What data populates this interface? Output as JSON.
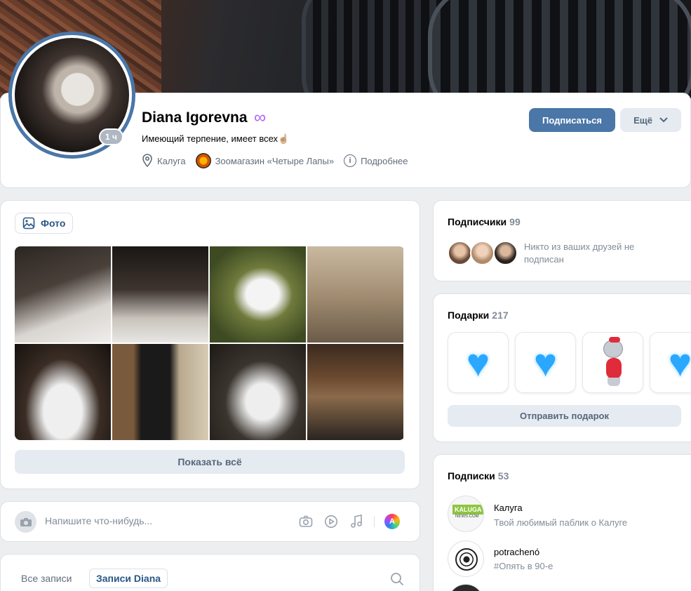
{
  "profile": {
    "name": "Diana Igorevna",
    "name_emoji": "∞",
    "status": "Имеющий терпение, имеет всех☝🏼",
    "online": "1 ч",
    "city": "Калуга",
    "work": "Зоомагазин «Четыре Лапы»",
    "more_info": "Подробнее",
    "subscribe_label": "Подписаться",
    "more_label": "Ещё"
  },
  "photos": {
    "tab_label": "Фото",
    "show_all": "Показать всё",
    "count_visible": 8
  },
  "composer": {
    "placeholder": "Напишите что-нибудь...",
    "ai_letter": "A"
  },
  "wall": {
    "tab_all": "Все записи",
    "tab_owner": "Записи Diana"
  },
  "followers": {
    "title": "Подписчики",
    "count": "99",
    "note": "Никто из ваших друзей не подписан"
  },
  "gifts": {
    "title": "Подарки",
    "count": "217",
    "send_label": "Отправить подарок",
    "items": [
      "blue-heart",
      "blue-heart",
      "cat-in-red-dress",
      "blue-heart"
    ]
  },
  "subscriptions": {
    "title": "Подписки",
    "count": "53",
    "items": [
      {
        "name": "Калуга",
        "desc": "Твой любимый паблик о Калуге",
        "logo": "KALUGA",
        "logo_sub": "NEWS.COM"
      },
      {
        "name": "potrachenó",
        "desc": "#Опять в 90-е"
      }
    ]
  },
  "colors": {
    "accent": "#4a76a8",
    "link": "#2a5885",
    "secondary_button": "#e5ebf1",
    "page_bg": "#edeef0"
  }
}
